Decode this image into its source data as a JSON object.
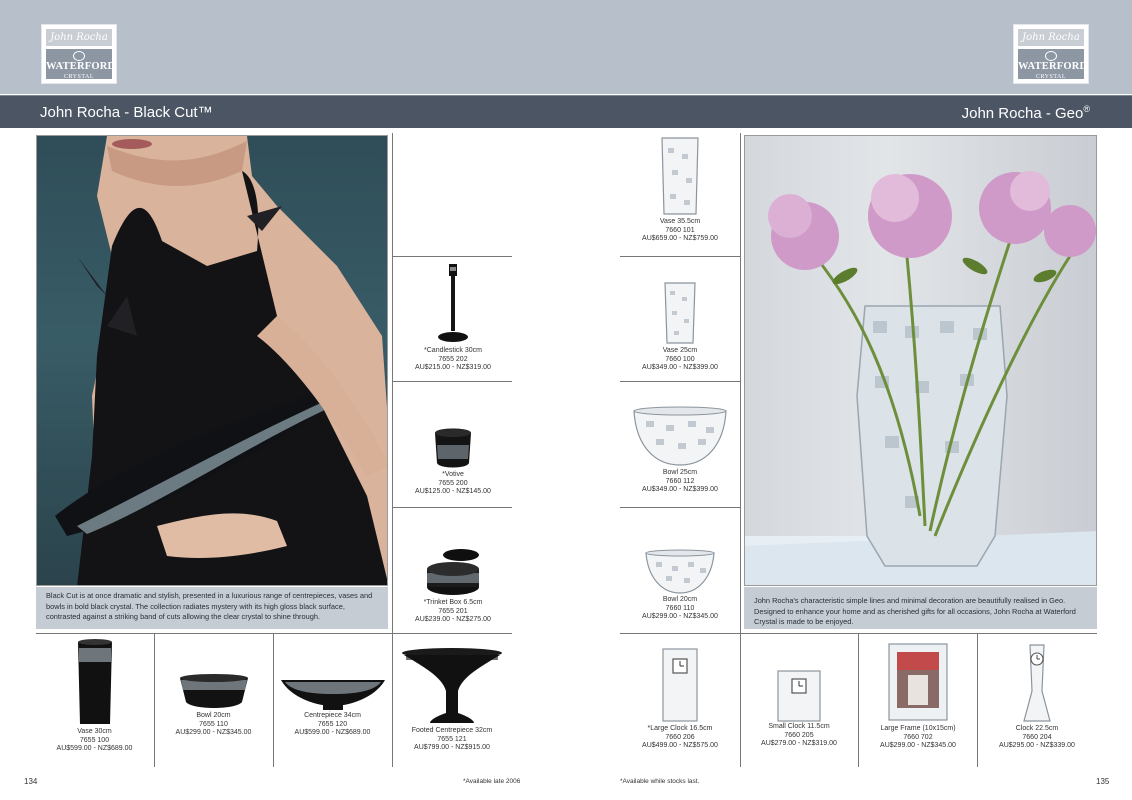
{
  "header": {
    "left_title": "John Rocha - Black Cut™",
    "right_title": "John Rocha - Geo",
    "right_title_mark": "®",
    "logo": {
      "signature": "John Rocha",
      "brand": "WATERFORD",
      "sub": "CRYSTAL"
    }
  },
  "captions": {
    "left": "Black Cut is at once dramatic and stylish, presented in a luxurious range of centrepieces, vases and bowls in bold black crystal. The collection radiates mystery with its high gloss black surface, contrasted against a striking band of cuts allowing the clear crystal to shine through.",
    "right": "John Rocha's characteristic simple lines and minimal decoration are beautifully realised in Geo. Designed to enhance your home and as cherished gifts for all occasions, John Rocha at Waterford Crystal is made to be enjoyed."
  },
  "products": {
    "candlestick": {
      "name": "*Candlestick 30cm",
      "code": "7655 202",
      "price": "AU$215.00  -  NZ$319.00"
    },
    "votive": {
      "name": "*Votive",
      "code": "7655 200",
      "price": "AU$125.00  -  NZ$145.00"
    },
    "trinket_box": {
      "name": "*Trinket Box 6.5cm",
      "code": "7655 201",
      "price": "AU$239.00  -  NZ$275.00"
    },
    "vase_30": {
      "name": "Vase 30cm",
      "code": "7655 100",
      "price": "AU$599.00  -  NZ$689.00"
    },
    "bowl_20_black": {
      "name": "Bowl 20cm",
      "code": "7655 110",
      "price": "AU$299.00  -  NZ$345.00"
    },
    "centrepiece_34": {
      "name": "Centrepiece 34cm",
      "code": "7655 120",
      "price": "AU$599.00  -  NZ$689.00"
    },
    "footed_centrepiece": {
      "name": "Footed Centrepiece 32cm",
      "code": "7655 121",
      "price": "AU$799.00  -  NZ$915.00"
    },
    "vase_35": {
      "name": "Vase 35.5cm",
      "code": "7660 101",
      "price": "AU$659.00  -  NZ$759.00"
    },
    "vase_25": {
      "name": "Vase 25cm",
      "code": "7660 100",
      "price": "AU$349.00  -  NZ$399.00"
    },
    "bowl_25": {
      "name": "Bowl 25cm",
      "code": "7660 112",
      "price": "AU$349.00  -  NZ$399.00"
    },
    "bowl_20_geo": {
      "name": "Bowl 20cm",
      "code": "7660 110",
      "price": "AU$299.00  -  NZ$345.00"
    },
    "large_clock": {
      "name": "*Large Clock 16.5cm",
      "code": "7660 206",
      "price": "AU$499.00  -  NZ$575.00"
    },
    "small_clock": {
      "name": "Small Clock 11.5cm",
      "code": "7660 205",
      "price": "AU$279.00  -  NZ$319.00"
    },
    "large_frame": {
      "name": "Large Frame (10x15cm)",
      "code": "7660 702",
      "price": "AU$299.00  -  NZ$345.00"
    },
    "clock_22": {
      "name": "Clock 22.5cm",
      "code": "7660 204",
      "price": "AU$295.00  -  NZ$339.00"
    }
  },
  "footer": {
    "page_left": "134",
    "page_right": "135",
    "note_left": "*Available late 2006",
    "note_right": "*Available while stocks last."
  },
  "colors": {
    "top_band": "#b6bfca",
    "title_bar": "#4b5564",
    "caption_bg": "#c5ccd4"
  }
}
